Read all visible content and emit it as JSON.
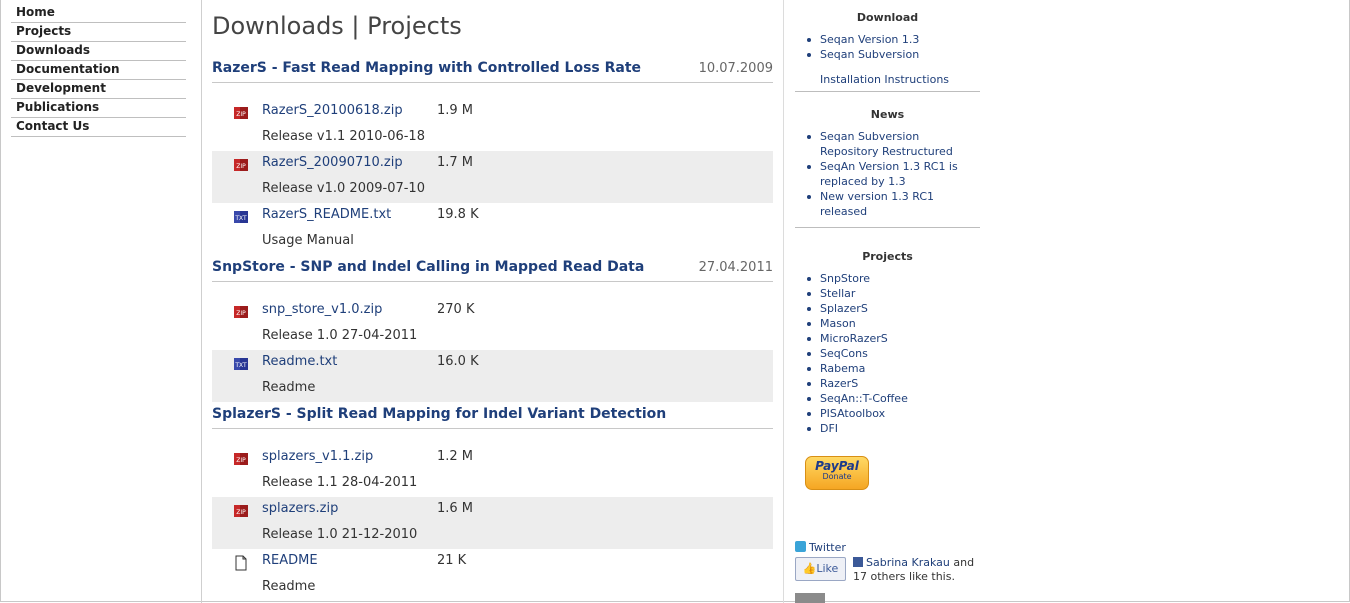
{
  "nav": {
    "items": [
      "Home",
      "Projects",
      "Downloads",
      "Documentation",
      "Development",
      "Publications",
      "Contact Us"
    ]
  },
  "main": {
    "title": "Downloads | Projects",
    "sections": [
      {
        "title": "RazerS - Fast Read Mapping with Controlled Loss Rate",
        "date": "10.07.2009",
        "files": [
          {
            "icon": "zip-icon",
            "name": "RazerS_20100618.zip",
            "size": "1.9 M",
            "desc": "Release v1.1 2010-06-18"
          },
          {
            "icon": "zip-icon",
            "name": "RazerS_20090710.zip",
            "size": "1.7 M",
            "desc": "Release v1.0 2009-07-10"
          },
          {
            "icon": "txt-icon",
            "name": "RazerS_README.txt",
            "size": "19.8 K",
            "desc": "Usage Manual"
          }
        ]
      },
      {
        "title": "SnpStore - SNP and Indel Calling in Mapped Read Data",
        "date": "27.04.2011",
        "files": [
          {
            "icon": "zip-icon",
            "name": "snp_store_v1.0.zip",
            "size": "270 K",
            "desc": "Release 1.0 27-04-2011"
          },
          {
            "icon": "txt-icon",
            "name": "Readme.txt",
            "size": "16.0 K",
            "desc": "Readme"
          }
        ]
      },
      {
        "title": "SplazerS - Split Read Mapping for Indel Variant Detection",
        "date": "",
        "files": [
          {
            "icon": "zip-icon",
            "name": "splazers_v1.1.zip",
            "size": "1.2 M",
            "desc": "Release 1.1 28-04-2011"
          },
          {
            "icon": "zip-icon",
            "name": "splazers.zip",
            "size": "1.6 M",
            "desc": "Release 1.0 21-12-2010"
          },
          {
            "icon": "file-icon",
            "name": "README",
            "size": "21 K",
            "desc": "Readme"
          }
        ]
      }
    ]
  },
  "sidebar": {
    "download": {
      "heading": "Download",
      "items": [
        "Seqan Version 1.3",
        "Seqan Subversion"
      ],
      "extra_link": "Installation Instructions"
    },
    "news": {
      "heading": "News",
      "items": [
        "Seqan Subversion Repository Restructured",
        "SeqAn Version 1.3 RC1 is replaced by 1.3",
        "New version 1.3 RC1 released"
      ]
    },
    "projects": {
      "heading": "Projects",
      "items": [
        "SnpStore",
        "Stellar",
        "SplazerS",
        "Mason",
        "MicroRazerS",
        "SeqCons",
        "Rabema",
        "RazerS",
        "SeqAn::T-Coffee",
        "PISAtoolbox",
        "DFI"
      ]
    },
    "paypal": {
      "brand": "PayPal",
      "label": "Donate"
    },
    "twitter": "Twitter",
    "like_button": "Like",
    "fb_name": "Sabrina Krakau",
    "fb_text": "and 17 others like this."
  }
}
